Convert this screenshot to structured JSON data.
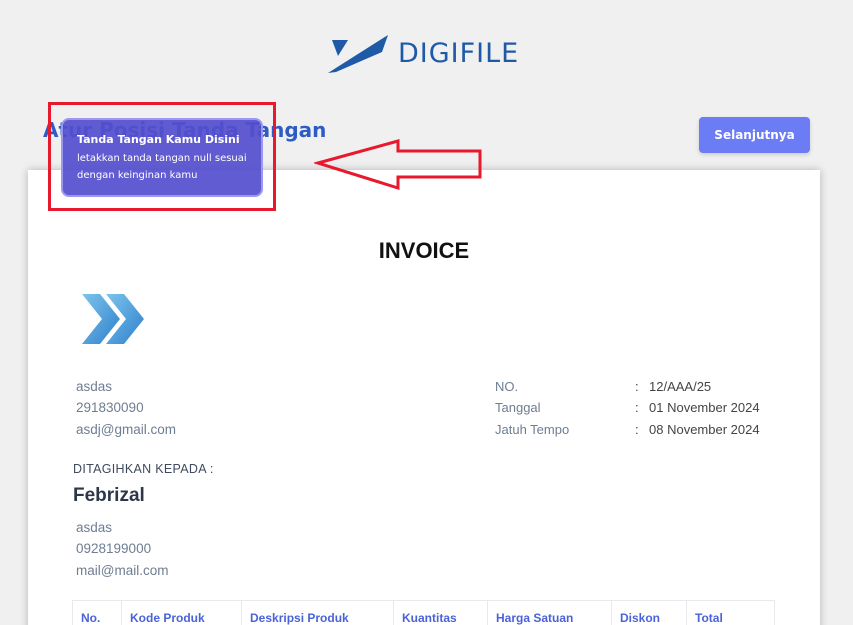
{
  "brand": {
    "name": "DIGIFILE",
    "color": "#1f5aa6"
  },
  "header": {
    "title": "Atur Posisi Tanda Tangan",
    "next_label": "Selanjutnya"
  },
  "signature_box": {
    "title": "Tanda Tangan Kamu Disini",
    "description": "letakkan tanda tangan null sesuai dengan keinginan kamu"
  },
  "invoice": {
    "title": "INVOICE",
    "logo_icon": "double-chevron-right-icon",
    "seller": {
      "name": "asdas",
      "phone": "291830090",
      "email": "asdj@gmail.com"
    },
    "meta": [
      {
        "label": "NO.",
        "value": "12/AAA/25"
      },
      {
        "label": "Tanggal",
        "value": "01 November 2024"
      },
      {
        "label": "Jatuh Tempo",
        "value": "08 November 2024"
      }
    ],
    "bill_to_label": "DITAGIHKAN KEPADA :",
    "client": {
      "name": "Febrizal",
      "address": "asdas",
      "phone": "0928199000",
      "email": "mail@mail.com"
    },
    "table_headers": [
      "No.",
      "Kode Produk",
      "Deskripsi Produk",
      "Kuantitas",
      "Harga Satuan",
      "Diskon",
      "Total"
    ]
  },
  "annotation_colors": {
    "highlight": "#e8192c",
    "accent": "#6b7cf5"
  }
}
